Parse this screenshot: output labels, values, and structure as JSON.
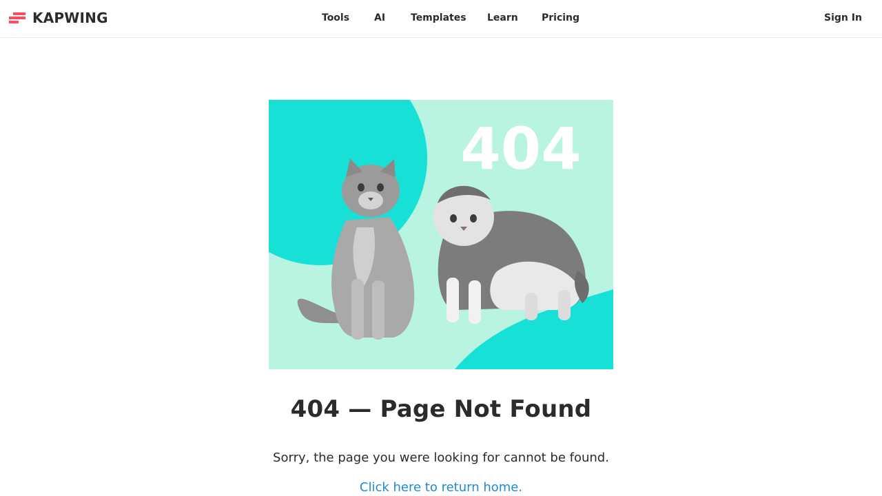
{
  "header": {
    "logo_text": "KAPWING",
    "logo_icon": "kapwing-logo-icon",
    "nav": [
      {
        "label": "Tools"
      },
      {
        "label": "AI"
      },
      {
        "label": "Templates"
      },
      {
        "label": "Learn"
      },
      {
        "label": "Pricing"
      }
    ],
    "sign_in_label": "Sign In"
  },
  "hero": {
    "image_text": "404",
    "alt": "Two cats in front of a 404 sign"
  },
  "content": {
    "title": "404 — Page Not Found",
    "message": "Sorry, the page you were looking for cannot be found.",
    "home_link": "Click here to return home."
  },
  "colors": {
    "brand_red": "#ff4b5f",
    "hero_bg": "#b9f3e1",
    "hero_accent": "#17e1d6",
    "link": "#1a8ad9",
    "text": "#2b2b2b"
  }
}
